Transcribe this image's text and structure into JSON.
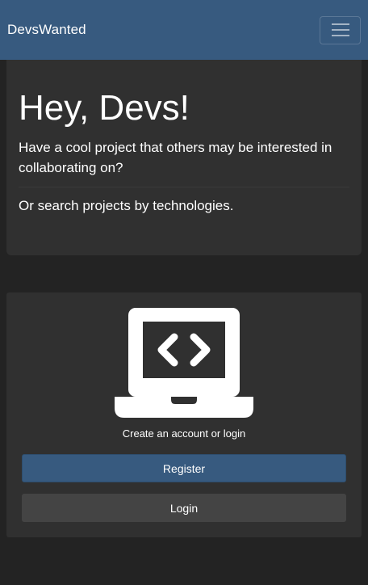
{
  "navbar": {
    "brand": "DevsWanted",
    "toggle_icon": "hamburger-menu-icon"
  },
  "hero": {
    "title": "Hey, Devs!",
    "lead": "Have a cool project that others may be interested in collaborating on?",
    "sub": "Or search projects by technologies."
  },
  "auth_card": {
    "icon": "laptop-code-icon",
    "caption": "Create an account or login",
    "register_label": "Register",
    "login_label": "Login"
  },
  "colors": {
    "background": "#232323",
    "navbar": "#375a7f",
    "card": "#303030",
    "primary": "#375a7f",
    "secondary": "#444444"
  }
}
